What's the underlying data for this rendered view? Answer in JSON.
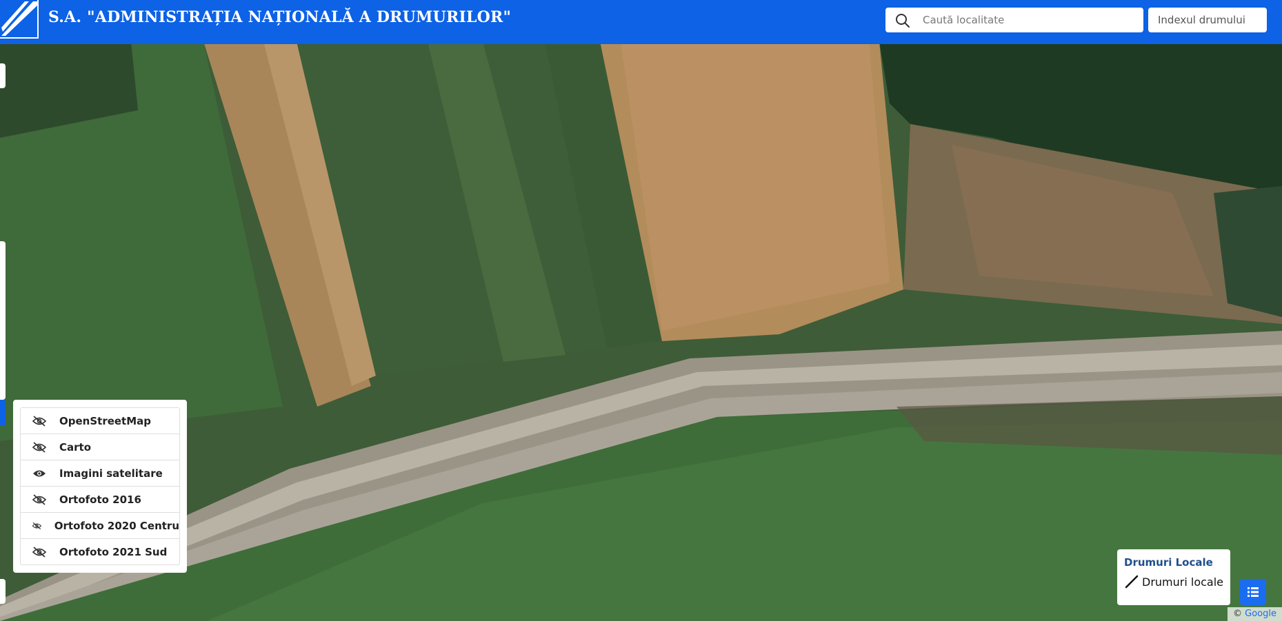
{
  "header": {
    "title": "S.A. \"ADMINISTRAȚIA NAȚIONALĂ A DRUMURILOR\"",
    "search_placeholder": "Caută localitate",
    "road_index_label": "Indexul drumului"
  },
  "layers": {
    "items": [
      {
        "label": "OpenStreetMap",
        "visible": false
      },
      {
        "label": "Carto",
        "visible": false
      },
      {
        "label": "Imagini satelitare",
        "visible": true
      },
      {
        "label": "Ortofoto 2016",
        "visible": false
      },
      {
        "label": "Ortofoto 2020 Centru",
        "visible": false
      },
      {
        "label": "Ortofoto 2021 Sud",
        "visible": false
      }
    ]
  },
  "legend": {
    "title": "Drumuri Locale",
    "item_label": "Drumuri locale"
  },
  "attribution": {
    "prefix": "©",
    "link": "Google"
  },
  "colors": {
    "header": "#0d62e6",
    "legend_title": "#1f4f8a",
    "button": "#1a6cf0"
  }
}
